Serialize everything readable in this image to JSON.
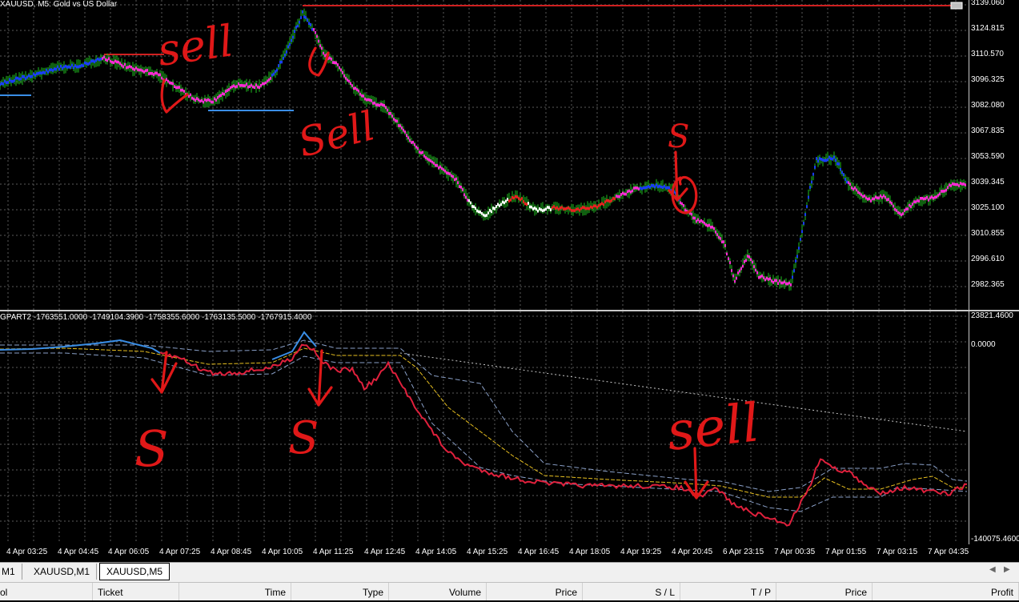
{
  "chart": {
    "title": "XAUUSD, M5:  Gold vs US Dollar",
    "price_ticks": [
      "3139.060",
      "3124.815",
      "3110.570",
      "3096.325",
      "3082.080",
      "3067.835",
      "3053.590",
      "3039.345",
      "3025.100",
      "3010.855",
      "2996.610",
      "2982.365"
    ],
    "current_price_label": "3139.060"
  },
  "indicator": {
    "title": "GPART2 -1763551.0000 -1749104.3900 -1758355.6000 -1763135.5000 -1767915.4000",
    "ticks": [
      "23821.4600",
      "0.0000",
      "-140075.4600"
    ]
  },
  "time_labels": [
    "4 Apr 03:25",
    "4 Apr 04:45",
    "4 Apr 06:05",
    "4 Apr 07:25",
    "4 Apr 08:45",
    "4 Apr 10:05",
    "4 Apr 11:25",
    "4 Apr 12:45",
    "4 Apr 14:05",
    "4 Apr 15:25",
    "4 Apr 16:45",
    "4 Apr 18:05",
    "4 Apr 19:25",
    "4 Apr 20:45",
    "6 Apr 23:15",
    "7 Apr 00:35",
    "7 Apr 01:55",
    "7 Apr 03:15",
    "7 Apr 04:35"
  ],
  "tabs": [
    "M1",
    "XAUUSD,M1",
    "XAUUSD,M5"
  ],
  "terminal_columns": [
    "ol",
    "Ticket",
    "Time",
    "Type",
    "Volume",
    "Price",
    "S / L",
    "T / P",
    "Price",
    "Profit"
  ],
  "annotations": {
    "sell_1": "sell",
    "sell_2": "Sell",
    "sell_3": "sell",
    "s_1": "S",
    "s_2": "S",
    "s_3": "S"
  },
  "colors": {
    "background": "#000000",
    "grid": "#5a5a5a",
    "bull": "#1a3cff",
    "bear": "#ff2ad4",
    "neutral_white": "#ffffff",
    "neutral_red": "#e82020",
    "wick": "#1fbf1f",
    "indicator_main": "#e0203c",
    "indicator_blue": "#3a8ee6",
    "indicator_yellow": "#e8c020",
    "indicator_band": "#8aa0c8",
    "annotation": "#e01818"
  }
}
